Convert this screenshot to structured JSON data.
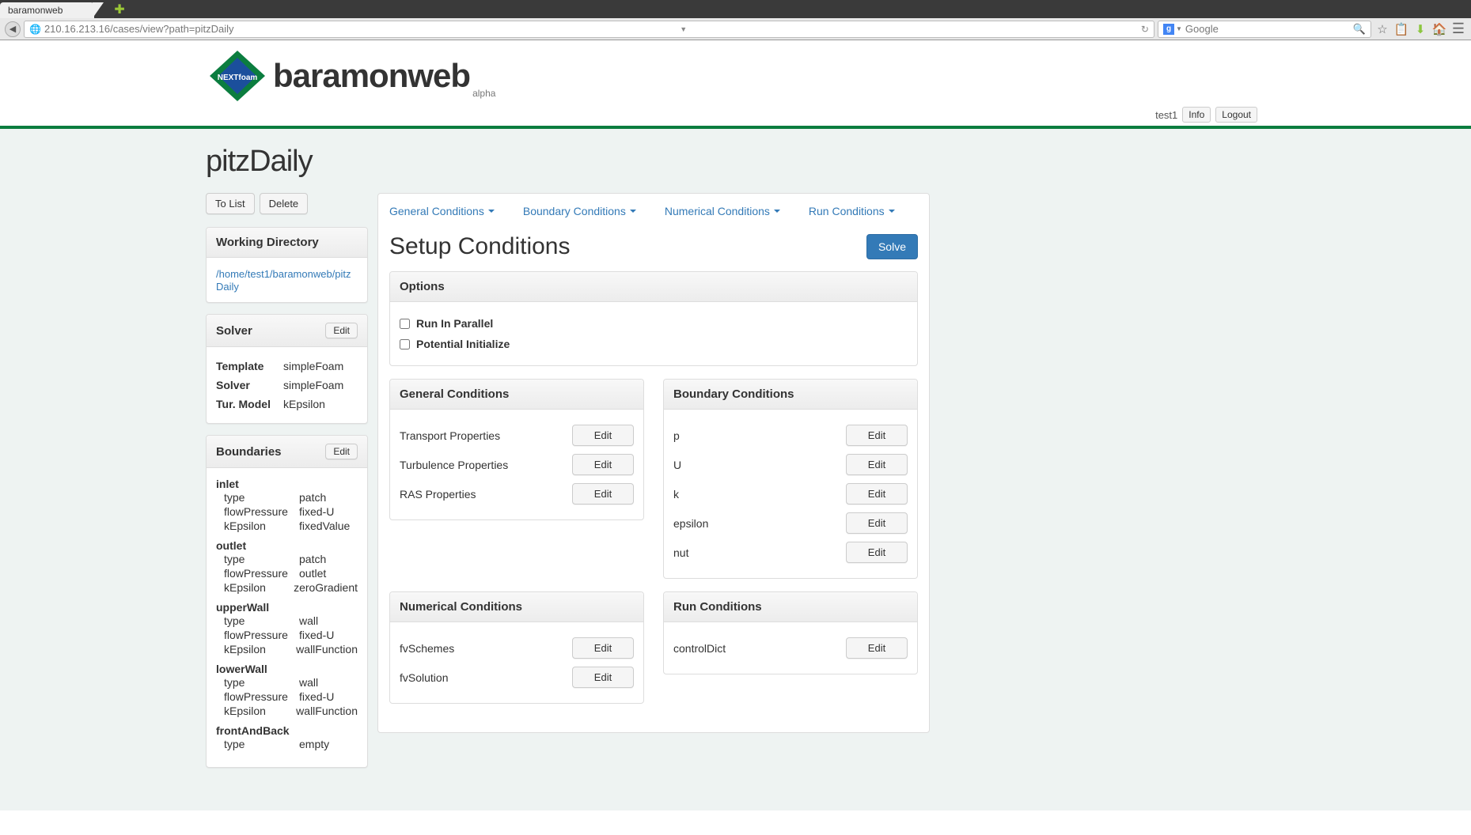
{
  "browser": {
    "tab_title": "baramonweb",
    "url": "210.16.213.16/cases/view?path=pitzDaily",
    "search_placeholder": "Google"
  },
  "header": {
    "logo_text": "NEXTfoam",
    "brand": "baramonweb",
    "brand_sub": "alpha",
    "user": "test1",
    "info_label": "Info",
    "logout_label": "Logout"
  },
  "case": {
    "title": "pitzDaily",
    "to_list_label": "To List",
    "delete_label": "Delete"
  },
  "sidebar": {
    "working_dir_title": "Working Directory",
    "working_dir_path": "/home/test1/baramonweb/pitzDaily",
    "solver_title": "Solver",
    "solver_edit": "Edit",
    "solver_rows": [
      {
        "k": "Template",
        "v": "simpleFoam"
      },
      {
        "k": "Solver",
        "v": "simpleFoam"
      },
      {
        "k": "Tur. Model",
        "v": "kEpsilon"
      }
    ],
    "boundaries_title": "Boundaries",
    "boundaries_edit": "Edit",
    "boundaries": [
      {
        "name": "inlet",
        "rows": [
          {
            "k": "type",
            "v": "patch"
          },
          {
            "k": "flowPressure",
            "v": "fixed-U"
          },
          {
            "k": "kEpsilon",
            "v": "fixedValue"
          }
        ]
      },
      {
        "name": "outlet",
        "rows": [
          {
            "k": "type",
            "v": "patch"
          },
          {
            "k": "flowPressure",
            "v": "outlet"
          },
          {
            "k": "kEpsilon",
            "v": "zeroGradient"
          }
        ]
      },
      {
        "name": "upperWall",
        "rows": [
          {
            "k": "type",
            "v": "wall"
          },
          {
            "k": "flowPressure",
            "v": "fixed-U"
          },
          {
            "k": "kEpsilon",
            "v": "wallFunction"
          }
        ]
      },
      {
        "name": "lowerWall",
        "rows": [
          {
            "k": "type",
            "v": "wall"
          },
          {
            "k": "flowPressure",
            "v": "fixed-U"
          },
          {
            "k": "kEpsilon",
            "v": "wallFunction"
          }
        ]
      },
      {
        "name": "frontAndBack",
        "rows": [
          {
            "k": "type",
            "v": "empty"
          }
        ]
      }
    ]
  },
  "tabs": [
    "General Conditions",
    "Boundary Conditions",
    "Numerical Conditions",
    "Run Conditions"
  ],
  "main": {
    "title": "Setup Conditions",
    "solve_label": "Solve",
    "options_title": "Options",
    "options": [
      "Run In Parallel",
      "Potential Initialize"
    ],
    "general_title": "General Conditions",
    "general_items": [
      "Transport Properties",
      "Turbulence Properties",
      "RAS Properties"
    ],
    "boundary_title": "Boundary Conditions",
    "boundary_items": [
      "p",
      "U",
      "k",
      "epsilon",
      "nut"
    ],
    "numerical_title": "Numerical Conditions",
    "numerical_items": [
      "fvSchemes",
      "fvSolution"
    ],
    "run_title": "Run Conditions",
    "run_items": [
      "controlDict"
    ],
    "edit_label": "Edit"
  }
}
